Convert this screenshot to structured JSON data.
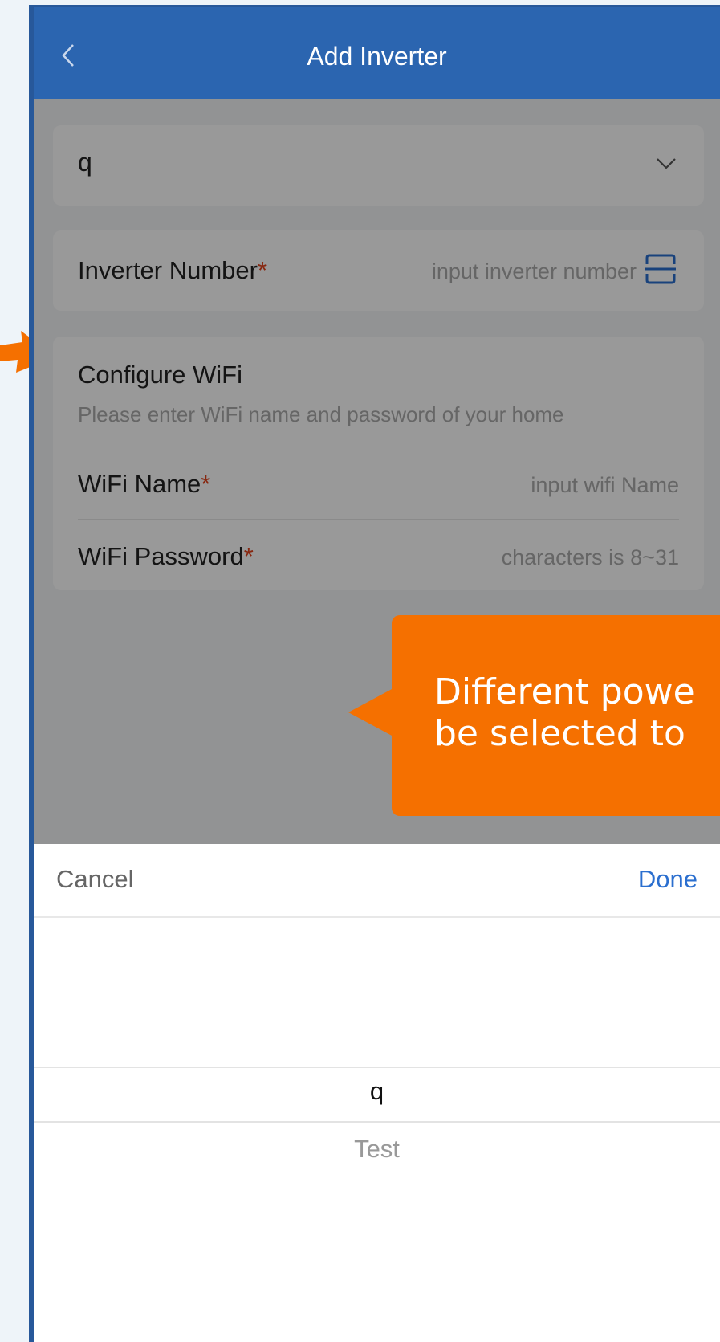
{
  "header": {
    "title": "Add Inverter",
    "back_icon": "chevron-left-icon"
  },
  "power_station_select": {
    "value": "q",
    "icon": "chevron-down-icon"
  },
  "inverter": {
    "label": "Inverter Number",
    "required": "*",
    "placeholder": "input inverter number",
    "scan_icon": "scan-icon"
  },
  "wifi": {
    "title": "Configure WiFi",
    "hint": "Please enter WiFi name and password of your home",
    "name_label": "WiFi Name",
    "name_placeholder": "input wifi Name",
    "password_label": "WiFi Password",
    "password_placeholder": "characters is 8~31",
    "required": "*"
  },
  "callout": {
    "line1": "Different powe",
    "line2": "be selected to"
  },
  "picker": {
    "cancel": "Cancel",
    "done": "Done",
    "options": [
      "q",
      "Test"
    ],
    "selected": "q"
  },
  "colors": {
    "header": "#2b65b0",
    "accent": "#2b6fcf",
    "callout": "#f57000",
    "required": "#e2421b"
  }
}
